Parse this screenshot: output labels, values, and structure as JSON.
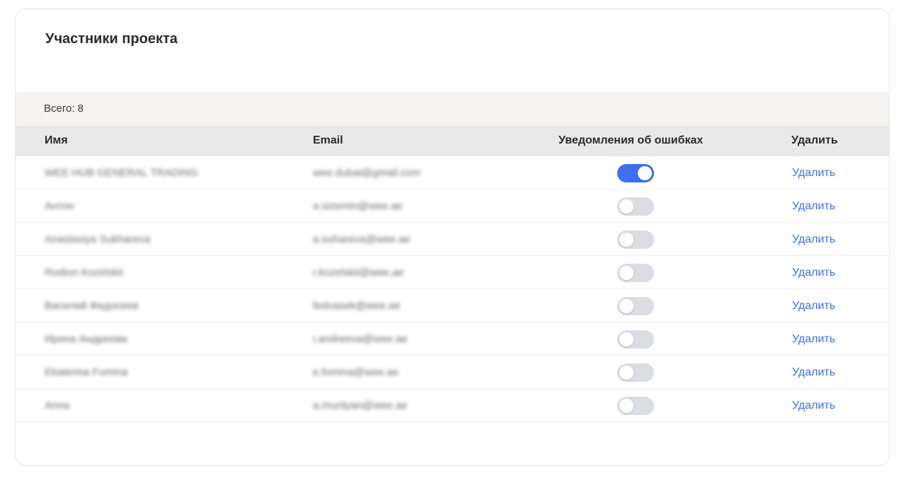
{
  "page": {
    "title": "Участники проекта",
    "total_label": "Всего: 8"
  },
  "table": {
    "headers": {
      "name": "Имя",
      "email": "Email",
      "notifications": "Уведомления об ошибках",
      "delete": "Удалить"
    },
    "rows": [
      {
        "name": "WEE HUB GENERAL TRADING",
        "email": "wee.dubai@gmail.com",
        "notifications_on": true,
        "delete_label": "Удалить"
      },
      {
        "name": "Антон",
        "email": "a.sizemin@wee.ae",
        "notifications_on": false,
        "delete_label": "Удалить"
      },
      {
        "name": "Anastasiya Sukhareva",
        "email": "a.suhareva@wee.ae",
        "notifications_on": false,
        "delete_label": "Удалить"
      },
      {
        "name": "Rodion Kozelskii",
        "email": "r.kozelskii@wee.ae",
        "notifications_on": false,
        "delete_label": "Удалить"
      },
      {
        "name": "Василий Федосеев",
        "email": "fedvasek@wee.ae",
        "notifications_on": false,
        "delete_label": "Удалить"
      },
      {
        "name": "Ирина Андреева",
        "email": "i.andreeva@wee.ae",
        "notifications_on": false,
        "delete_label": "Удалить"
      },
      {
        "name": "Ekaterina Fomina",
        "email": "e.fomina@wee.ae",
        "notifications_on": false,
        "delete_label": "Удалить"
      },
      {
        "name": "Anna",
        "email": "a.muntyan@wee.ae",
        "notifications_on": false,
        "delete_label": "Удалить"
      }
    ]
  },
  "colors": {
    "accent": "#3d6ff0",
    "toggle_off": "#dcdde3",
    "total_bar_bg": "#f4f3f1",
    "header_bg": "#e9e9e9"
  }
}
